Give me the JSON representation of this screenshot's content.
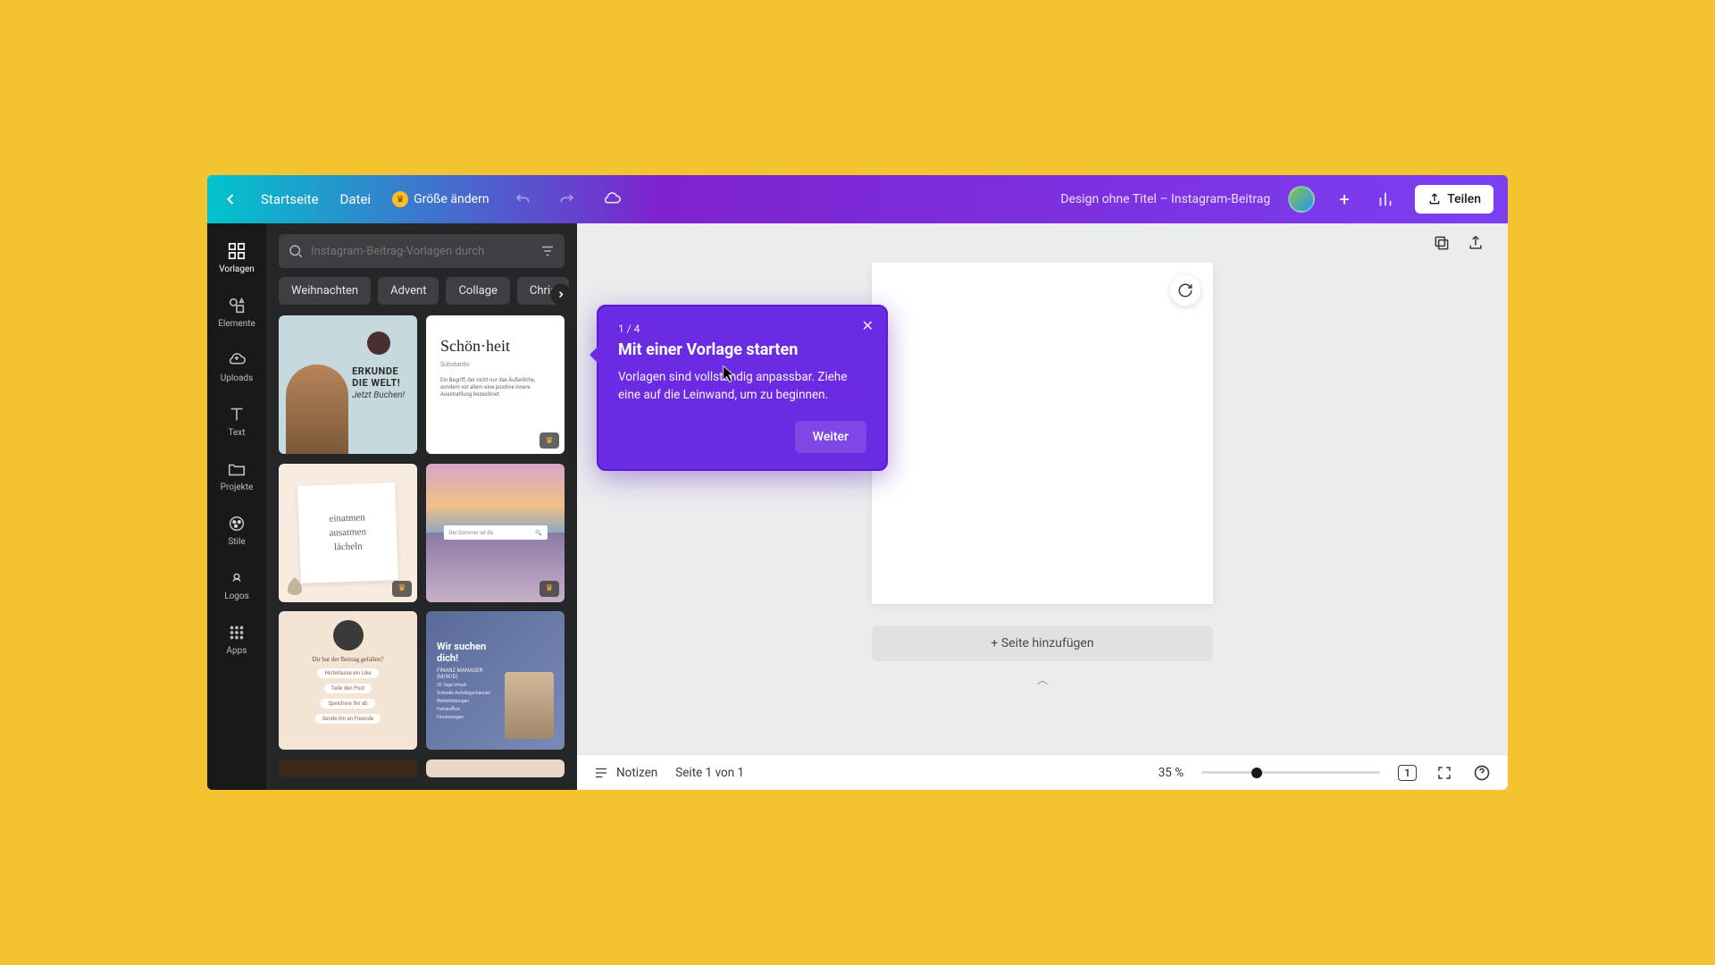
{
  "colors": {
    "accent": "#6a2be2",
    "top_left": "#01c4cc",
    "top_right": "#7b3ff2",
    "yellow_bg": "#f4c430"
  },
  "topbar": {
    "home": "Startseite",
    "file": "Datei",
    "resize": "Größe ändern",
    "doc_title": "Design ohne Titel – Instagram-Beitrag",
    "share": "Teilen"
  },
  "rail": {
    "templates": "Vorlagen",
    "elements": "Elemente",
    "uploads": "Uploads",
    "text": "Text",
    "projects": "Projekte",
    "styles": "Stile",
    "logos": "Logos",
    "apps": "Apps"
  },
  "search": {
    "placeholder": "Instagram-Beitrag-Vorlagen durch"
  },
  "chips": [
    "Weihnachten",
    "Advent",
    "Collage",
    "Chris"
  ],
  "templates": {
    "t1": {
      "line1": "ERKUNDE",
      "line2": "DIE WELT!",
      "sub": "Jetzt Buchen!"
    },
    "t2": {
      "title": "Schön·heit",
      "sub": "Substantiv",
      "p": "Ein Begriff, der nicht nur das Äußerliche, sondern vor allem eine positive innere Ausstrahlung bezeichnet."
    },
    "t3": {
      "l1": "einatmen",
      "l2": "ausatmen",
      "l3": "lächeln"
    },
    "t4": {
      "bar": "Der Sommer ist da"
    },
    "t5": {
      "q": "Dir hat der Beitrag gefallen?",
      "b1": "Hinterlasse ein Like",
      "b2": "Teile den Post",
      "b3": "Speichere ihn ab",
      "b4": "Sende ihn an Freunde"
    },
    "t6": {
      "h": "Wir suchen dich!",
      "s": "FINANZ MANAGER (M/W/D)",
      "li1": "30 Tage Urlaub",
      "li2": "Schnelle Aufstiegschancen",
      "li3": "Weiterbildungen",
      "li4": "Homeoffice",
      "li5": "Firmenwagen"
    }
  },
  "canvas": {
    "add_page": "+ Seite hinzufügen"
  },
  "tour": {
    "step": "1 / 4",
    "title": "Mit einer Vorlage starten",
    "desc": "Vorlagen sind vollständig anpassbar. Ziehe eine auf die Leinwand, um zu beginnen.",
    "cta": "Weiter"
  },
  "footer": {
    "notes": "Notizen",
    "page_info": "Seite 1 von 1",
    "zoom": "35 %",
    "page_count": "1"
  }
}
